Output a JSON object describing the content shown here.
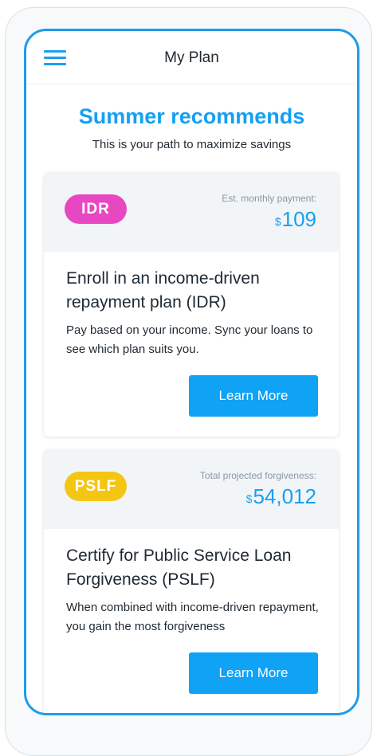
{
  "header": {
    "title": "My Plan"
  },
  "hero": {
    "title": "Summer recommends",
    "subtitle": "This is your path to maximize savings"
  },
  "cards": [
    {
      "badge": "IDR",
      "badge_color": "#e847c2",
      "metric_label": "Est. monthly payment:",
      "currency": "$",
      "metric_value": "109",
      "heading": "Enroll in an income-driven repayment plan (IDR)",
      "body": "Pay based on your income. Sync your loans to see which plan suits you.",
      "button": "Learn More"
    },
    {
      "badge": "PSLF",
      "badge_color": "#f5c514",
      "metric_label": "Total projected forgiveness:",
      "currency": "$",
      "metric_value": "54,012",
      "heading": "Certify for Public Service Loan Forgiveness (PSLF)",
      "body": "When combined with income-driven repayment, you gain the most forgiveness",
      "button": "Learn More"
    }
  ],
  "colors": {
    "accent": "#1a9fee",
    "frame": "#1e9bea",
    "button": "#0fa2f5"
  }
}
